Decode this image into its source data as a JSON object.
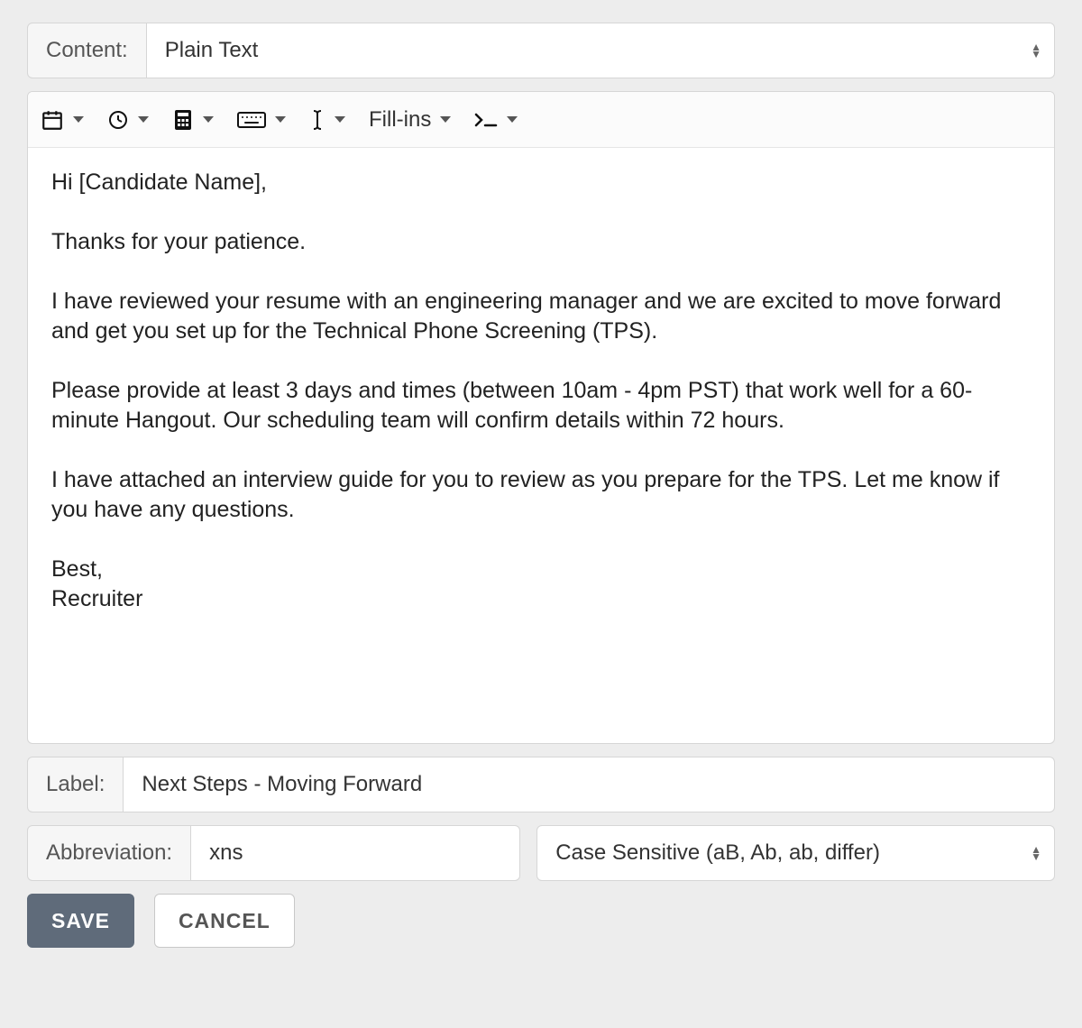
{
  "content_row": {
    "label": "Content:",
    "selected": "Plain Text"
  },
  "toolbar": {
    "fillins_label": "Fill-ins"
  },
  "editor": {
    "body": "Hi [Candidate Name],\n\nThanks for your patience.\n\nI have reviewed your resume with an engineering manager and we are excited to move forward and get you set up for the Technical Phone Screening (TPS).\n\nPlease provide at least 3 days and times (between 10am - 4pm PST) that work well for a 60-minute Hangout. Our scheduling team will confirm details within 72 hours.\n\nI have attached an interview guide for you to review as you prepare for the TPS. Let me know if you have any questions.\n\nBest,\nRecruiter"
  },
  "label_row": {
    "label": "Label:",
    "value": "Next Steps - Moving Forward"
  },
  "abbrev_row": {
    "label": "Abbreviation:",
    "value": "xns",
    "case_selected": "Case Sensitive (aB, Ab, ab, differ)"
  },
  "buttons": {
    "save": "SAVE",
    "cancel": "CANCEL"
  }
}
